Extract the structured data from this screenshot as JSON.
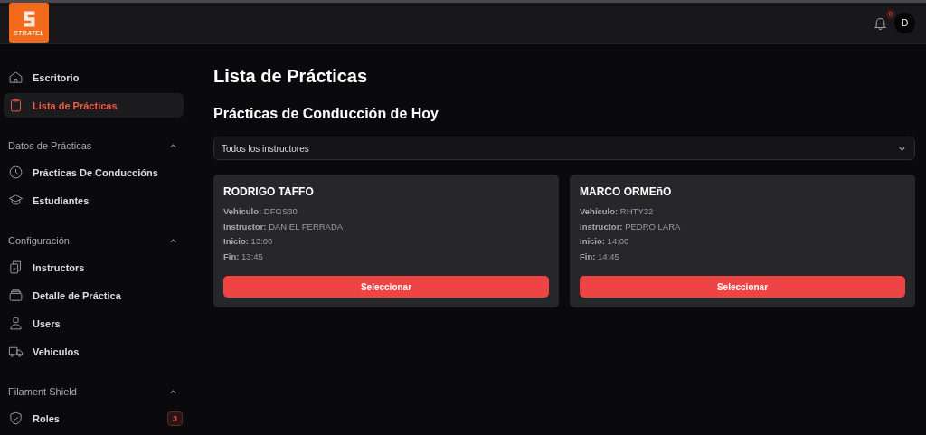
{
  "topbar": {
    "logo": "STRATEL",
    "notifications": "0",
    "avatar": "D"
  },
  "sidebar": {
    "items": [
      {
        "label": "Escritorio",
        "selected": false
      },
      {
        "label": "Lista de Prácticas",
        "selected": true
      }
    ],
    "groups": [
      {
        "heading": "Datos de Prácticas",
        "expanded": true,
        "items": [
          {
            "label": "Prácticas De Conduccións",
            "selected": false
          },
          {
            "label": "Estudiantes",
            "selected": false
          }
        ]
      },
      {
        "heading": "Configuración",
        "expanded": true,
        "items": [
          {
            "label": "Instructors",
            "selected": false
          },
          {
            "label": "Detalle de Práctica",
            "selected": false
          },
          {
            "label": "Users",
            "selected": false
          },
          {
            "label": "Vehiculos",
            "selected": false
          }
        ]
      },
      {
        "heading": "Filament Shield",
        "expanded": true,
        "items": [
          {
            "label": "Roles",
            "selected": false,
            "badge": "3"
          }
        ]
      }
    ]
  },
  "page_title": "Lista de Prácticas",
  "section_title": "Prácticas de Conducción de Hoy",
  "filter": {
    "value": "Todos los instructores"
  },
  "cards": [
    {
      "name": "RODRIGO TAFFO",
      "lines": [
        "**Vehículo:** DFGS30",
        "**Instructor:** DANIEL FERRADA",
        "**Inicio:** 13:00",
        "**Fin:** 13:45"
      ],
      "button": "Seleccionar"
    },
    {
      "name": "MARCO ORMEñO",
      "lines": [
        "**Vehículo:** RHTY32",
        "**Instructor:** PEDRO LARA",
        "**Inicio:** 14:00",
        "**Fin:** 14:45"
      ],
      "button": "Seleccionar"
    }
  ]
}
